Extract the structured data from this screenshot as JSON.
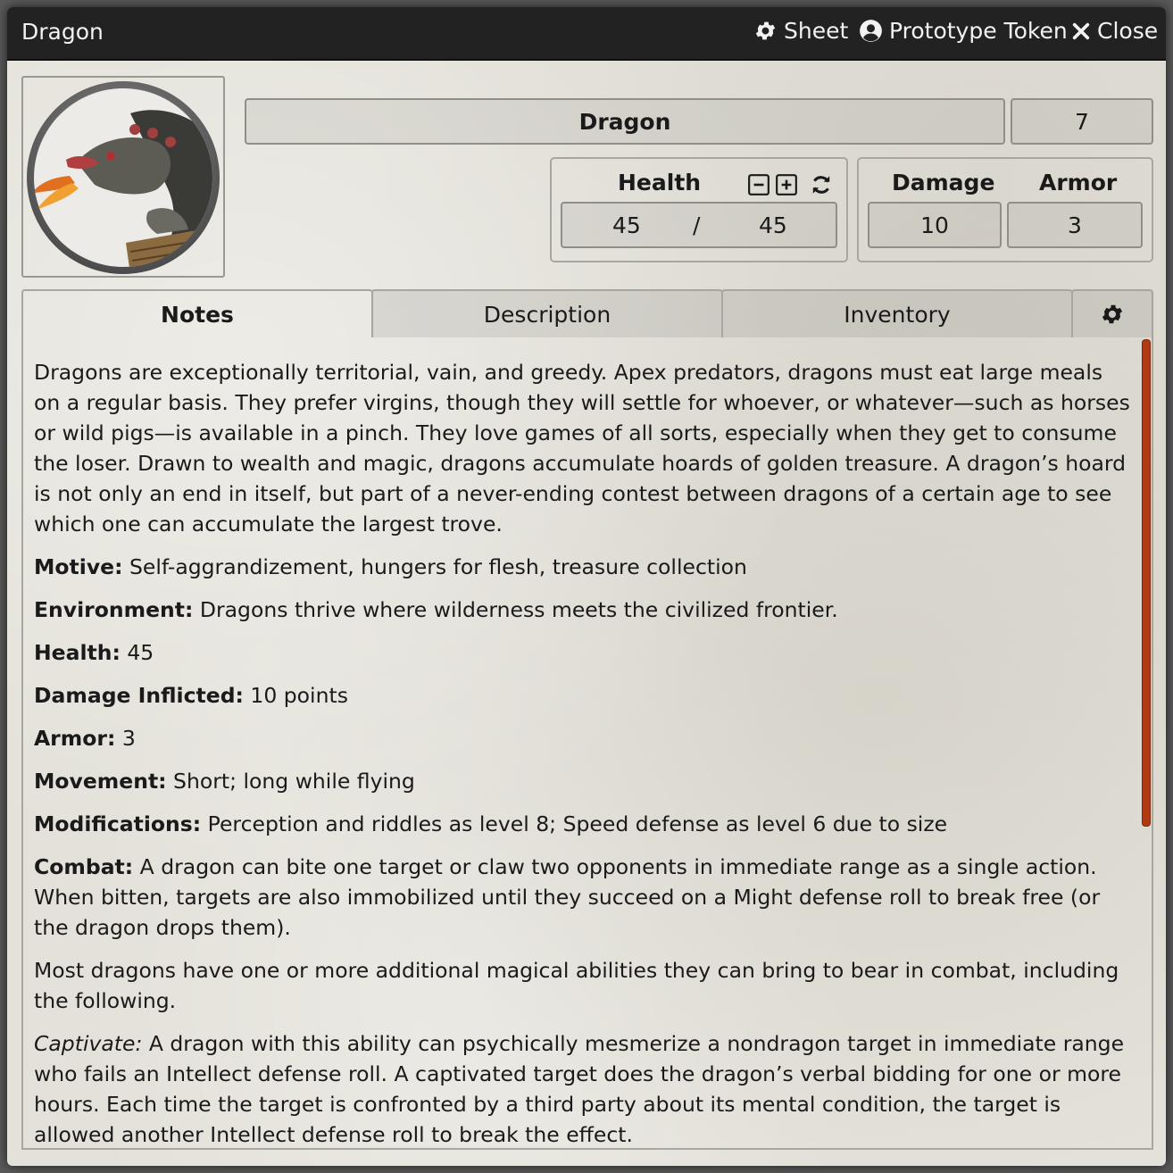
{
  "window": {
    "title": "Dragon",
    "header_buttons": {
      "sheet": "Sheet",
      "prototype_token": "Prototype Token",
      "close": "Close"
    }
  },
  "actor": {
    "name": "Dragon",
    "level": "7",
    "health_label": "Health",
    "health_value": "45",
    "health_sep": "/",
    "health_max": "45",
    "damage_label": "Damage",
    "damage_value": "10",
    "armor_label": "Armor",
    "armor_value": "3"
  },
  "tabs": [
    {
      "label": "Notes",
      "active": true
    },
    {
      "label": "Description",
      "active": false
    },
    {
      "label": "Inventory",
      "active": false
    }
  ],
  "notes": {
    "intro": "Dragons are exceptionally territorial, vain, and greedy. Apex predators, dragons must eat large meals on a regular basis. They prefer virgins, though they will settle for whoever, or whatever—such as horses or wild pigs—is available in a pinch. They love games of all sorts, especially when they get to consume the loser. Drawn to wealth and magic, dragons accumulate hoards of golden treasure. A dragon’s hoard is not only an end in itself, but part of a never-ending contest between dragons of a certain age to see which one can accumulate the largest trove.",
    "motive_label": "Motive:",
    "motive": " Self-aggrandizement, hungers for flesh, treasure collection",
    "environment_label": "Environment:",
    "environment": " Dragons thrive where wilderness meets the civilized frontier.",
    "health_label": "Health:",
    "health": " 45",
    "damage_label": "Damage Inflicted:",
    "damage": " 10 points",
    "armor_label": "Armor:",
    "armor": " 3",
    "movement_label": "Movement:",
    "movement": " Short; long while flying",
    "modifications_label": "Modifications:",
    "modifications": " Perception and riddles as level 8; Speed defense as level 6 due to size",
    "combat_label": "Combat:",
    "combat": " A dragon can bite one target or claw two opponents in immediate range as a single action. When bitten, targets are also immobilized until they succeed on a Might defense roll to break free (or the dragon drops them).",
    "abilities": "Most dragons have one or more additional magical abilities they can bring to bear in combat, including the following.",
    "captivate_label": "Captivate:",
    "captivate": " A dragon with this ability can psychically mesmerize a nondragon target in immediate range who fails an Intellect defense roll. A captivated target does the dragon’s verbal bidding for one or more hours. Each time the target is confronted by a third party about its mental condition, the target is allowed another Intellect defense roll to break the effect."
  },
  "icons": {
    "sheet": "gear-icon",
    "token": "user-circle-icon",
    "close": "close-icon",
    "minus": "minus-square-icon",
    "plus": "plus-square-icon",
    "reset": "refresh-icon",
    "settings": "gear-icon"
  },
  "colors": {
    "scrollbar": "#b03a12",
    "titlebar": "#222222",
    "parchment": "#e3e1d9"
  }
}
